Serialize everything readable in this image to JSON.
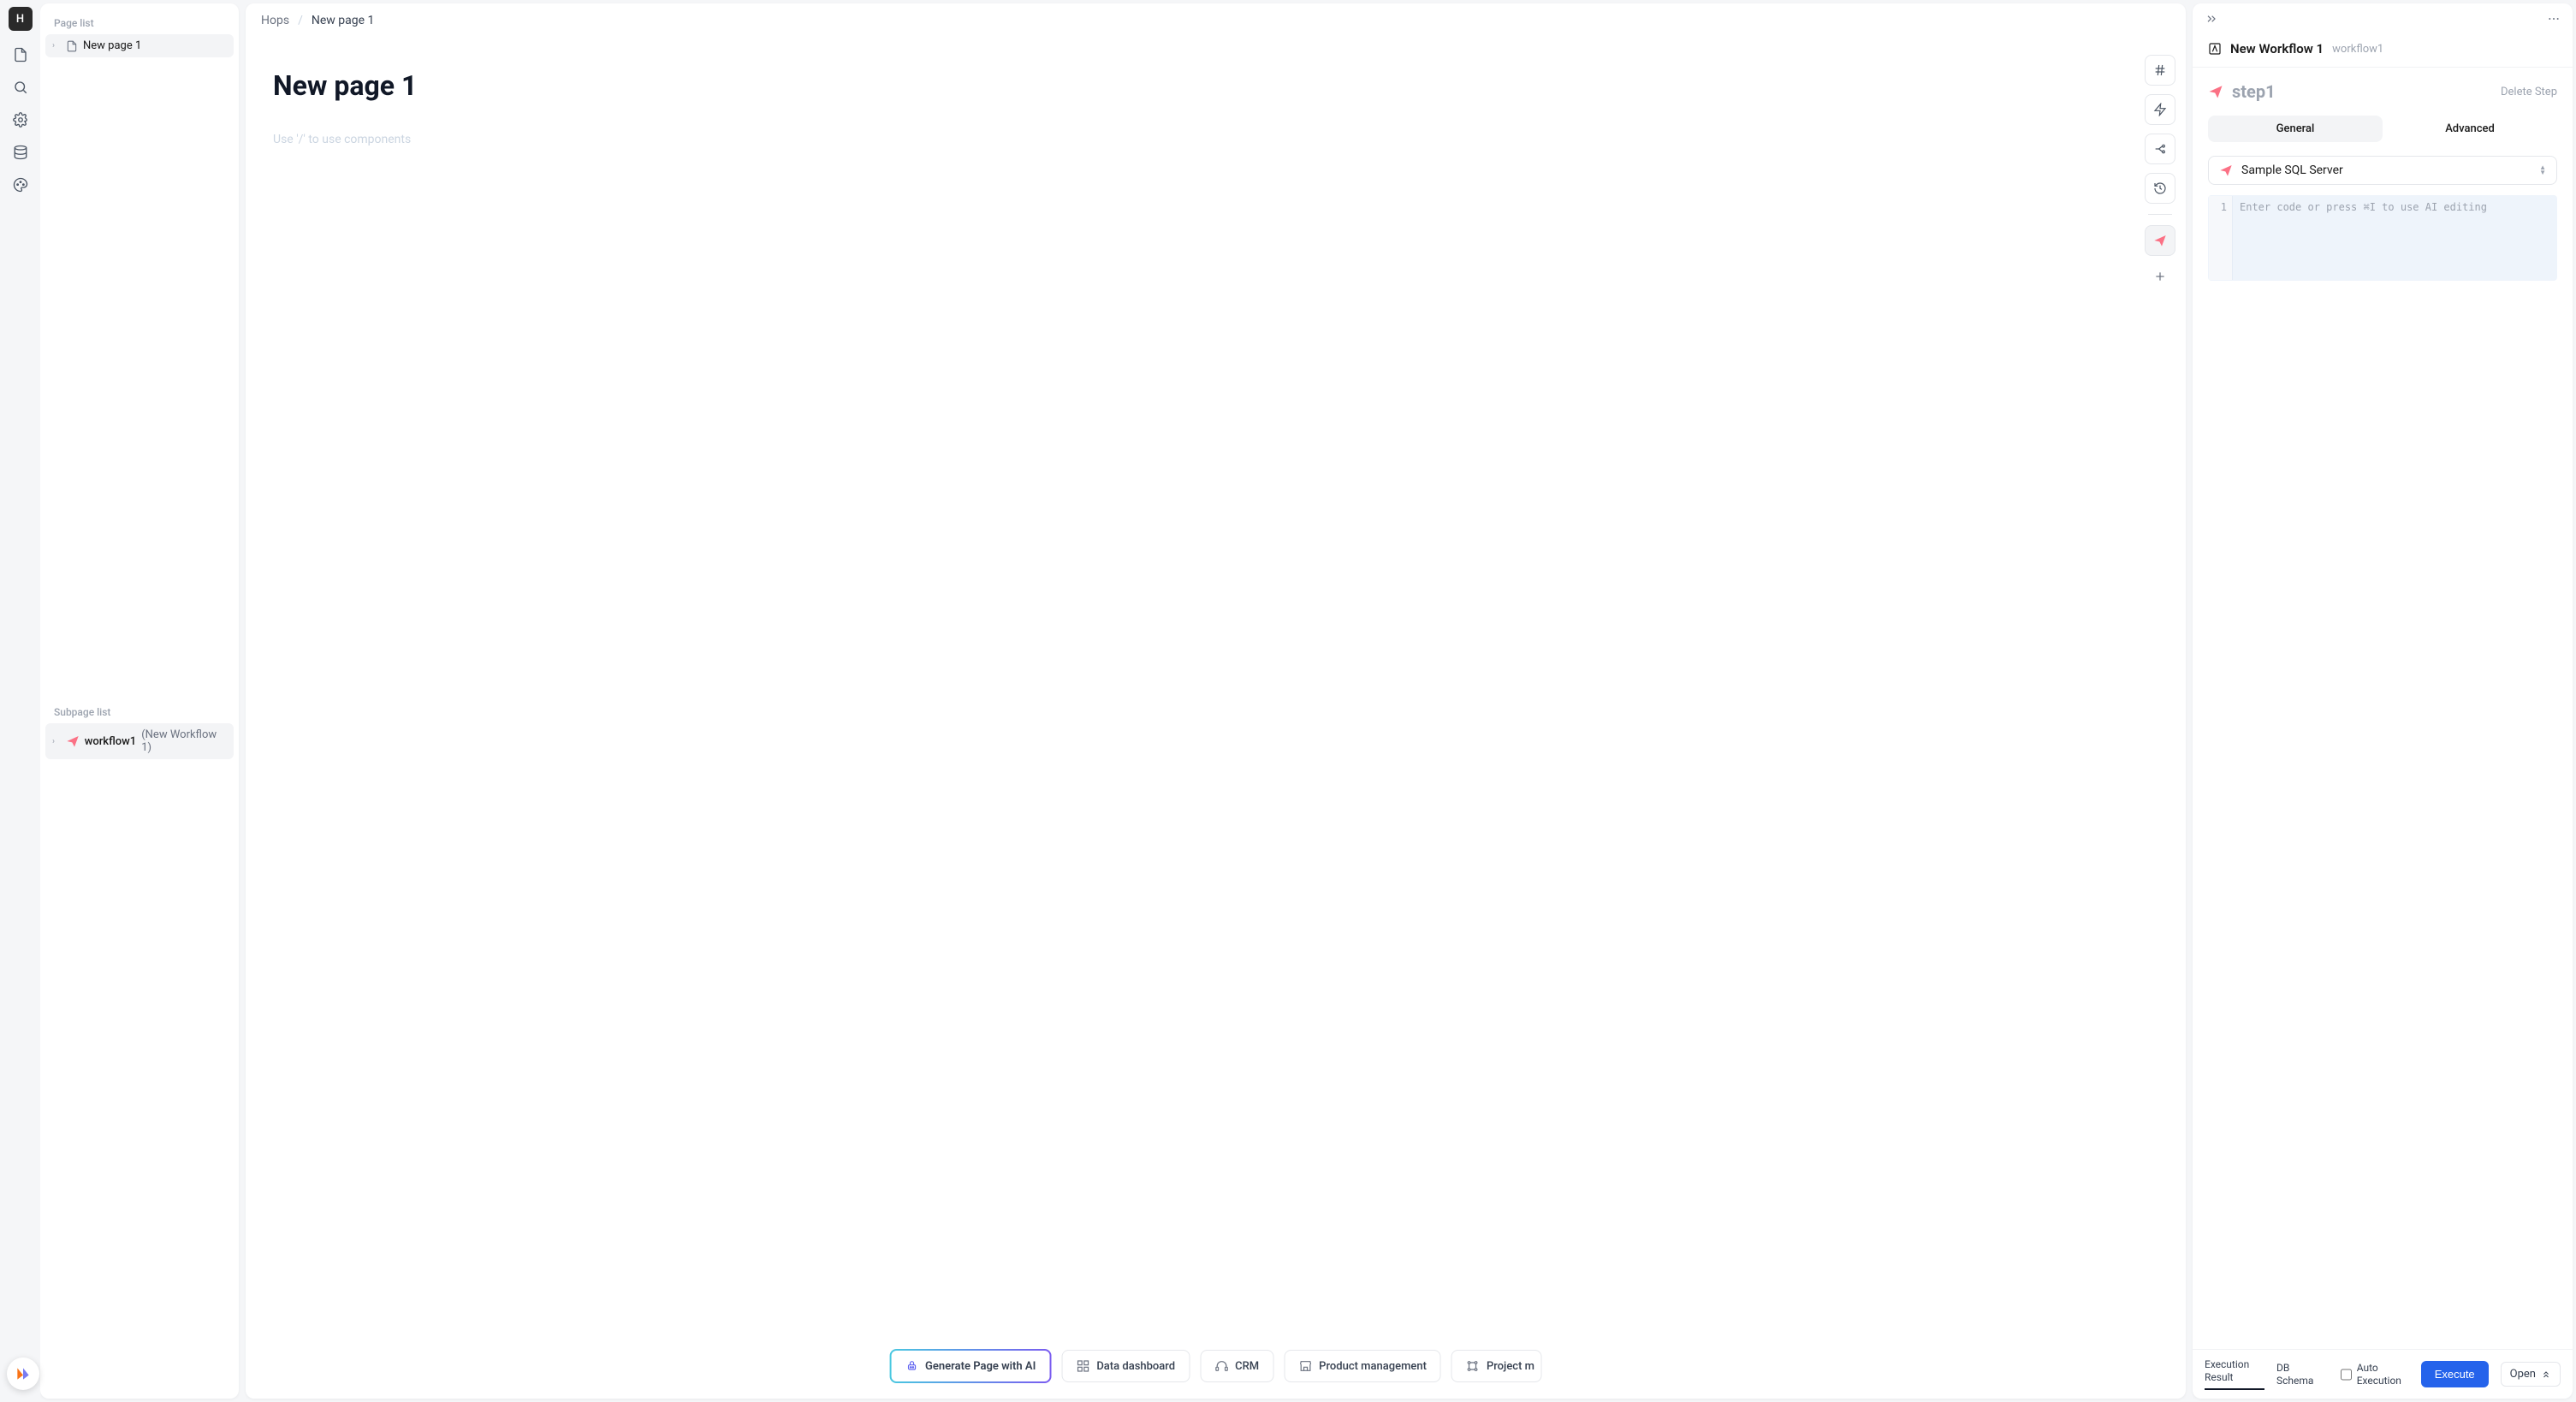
{
  "rail": {
    "avatar": "H"
  },
  "sidebar": {
    "page_list_heading": "Page list",
    "active_page": "New page 1",
    "subpage_heading": "Subpage list",
    "subpage_name": "workflow1",
    "subpage_paren": "(New Workflow 1)"
  },
  "breadcrumb": {
    "root": "Hops",
    "current": "New page 1"
  },
  "page": {
    "title": "New page 1",
    "placeholder": "Use '/' to use components"
  },
  "templates": {
    "ai": "Generate Page with AI",
    "dashboard": "Data dashboard",
    "crm": "CRM",
    "product": "Product management",
    "project": "Project m"
  },
  "right": {
    "workflow_title": "New Workflow 1",
    "workflow_id": "workflow1",
    "step_name": "step1",
    "delete_step": "Delete Step",
    "tab_general": "General",
    "tab_advanced": "Advanced",
    "datasource": "Sample SQL Server",
    "code_line": "1",
    "code_placeholder": "Enter code or press ⌘I to use AI editing",
    "footer": {
      "exec_result": "Execution Result",
      "db_schema": "DB Schema",
      "auto_exec": "Auto Execution",
      "execute": "Execute",
      "open": "Open"
    }
  }
}
